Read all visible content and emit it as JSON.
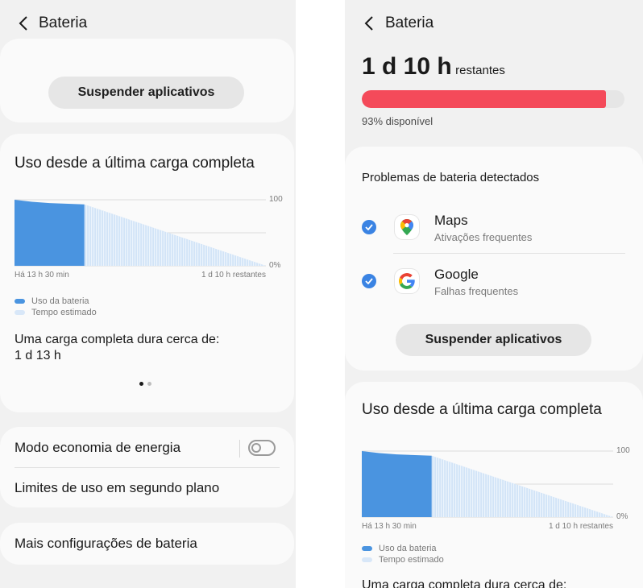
{
  "left": {
    "header": {
      "title": "Bateria"
    },
    "suspend_button": "Suspender aplicativos",
    "usage": {
      "title": "Uso desde a última carga completa",
      "chart_data": {
        "type": "area",
        "ylim": [
          0,
          100
        ],
        "y_ticks": [
          "100",
          "0%"
        ],
        "x_start_label": "Há 13 h 30 min",
        "x_end_label": "1 d 10 h restantes",
        "series": [
          {
            "name": "Uso da bateria",
            "color": "#4a94e0",
            "x": [
              0,
              0.25,
              0.5,
              1
            ],
            "y": [
              100,
              97,
              95,
              93
            ]
          },
          {
            "name": "Tempo estimado",
            "color": "#d2e4f7",
            "x": [
              1,
              3.6
            ],
            "y": [
              93,
              0
            ]
          }
        ]
      },
      "full_charge_label": "Uma carga completa dura cerca de:",
      "full_charge_value": "1 d 13 h"
    },
    "pager": {
      "current": 1,
      "total": 2
    },
    "settings": {
      "power_saving": "Modo economia de energia",
      "background_limits": "Limites de uso em segundo plano",
      "more": "Mais configurações de bateria"
    }
  },
  "right": {
    "header": {
      "title": "Bateria"
    },
    "remaining_value": "1 d 10 h",
    "remaining_suffix": "restantes",
    "battery_percent": 93,
    "battery_bar_color": "#f44a5a",
    "available_text": "93% disponível",
    "problems": {
      "title": "Problemas de bateria detectados",
      "apps": [
        {
          "name": "Maps",
          "detail": "Ativações frequentes",
          "icon": "google-maps-icon",
          "checked": true
        },
        {
          "name": "Google",
          "detail": "Falhas frequentes",
          "icon": "google-icon",
          "checked": true
        }
      ]
    },
    "suspend_button": "Suspender aplicativos",
    "usage": {
      "title": "Uso desde a última carga completa",
      "chart_data": {
        "type": "area",
        "ylim": [
          0,
          100
        ],
        "y_ticks": [
          "100",
          "0%"
        ],
        "x_start_label": "Há 13 h 30 min",
        "x_end_label": "1 d 10 h restantes",
        "series": [
          {
            "name": "Uso da bateria",
            "color": "#4a94e0",
            "x": [
              0,
              0.25,
              0.5,
              1
            ],
            "y": [
              100,
              97,
              95,
              93
            ]
          },
          {
            "name": "Tempo estimado",
            "color": "#d2e4f7",
            "x": [
              1,
              3.6
            ],
            "y": [
              93,
              0
            ]
          }
        ]
      },
      "full_charge_label": "Uma carga completa dura cerca de:"
    }
  }
}
